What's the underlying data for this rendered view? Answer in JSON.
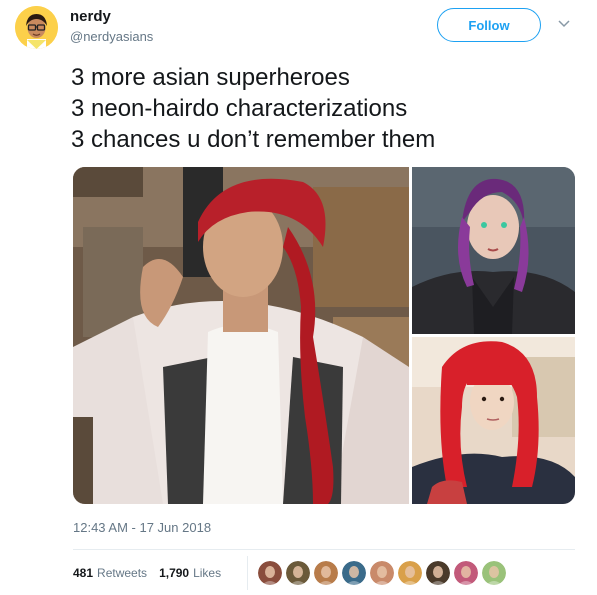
{
  "author": {
    "display_name": "nerdy",
    "handle": "@nerdyasians"
  },
  "follow_button": {
    "label": "Follow"
  },
  "tweet": {
    "lines": [
      "3 more asian superheroes",
      "3 neon-hairdo characterizations",
      "3 chances u don’t remember them"
    ],
    "timestamp": "12:43 AM - 17 Jun 2018"
  },
  "stats": {
    "retweets_count": "481",
    "retweets_label": "Retweets",
    "likes_count": "1,790",
    "likes_label": "Likes"
  },
  "likers": [
    {
      "color": "#8a4d3c"
    },
    {
      "color": "#6b5a3a"
    },
    {
      "color": "#b87c4a"
    },
    {
      "color": "#3a6b8a"
    },
    {
      "color": "#c98a6a"
    },
    {
      "color": "#d9a04a"
    },
    {
      "color": "#4a3a2a"
    },
    {
      "color": "#c25a7a"
    },
    {
      "color": "#9ac27a"
    }
  ],
  "colors": {
    "brand_blue": "#1da1f2",
    "muted_text": "#657786",
    "avatar_bg": "#fcd04a"
  }
}
